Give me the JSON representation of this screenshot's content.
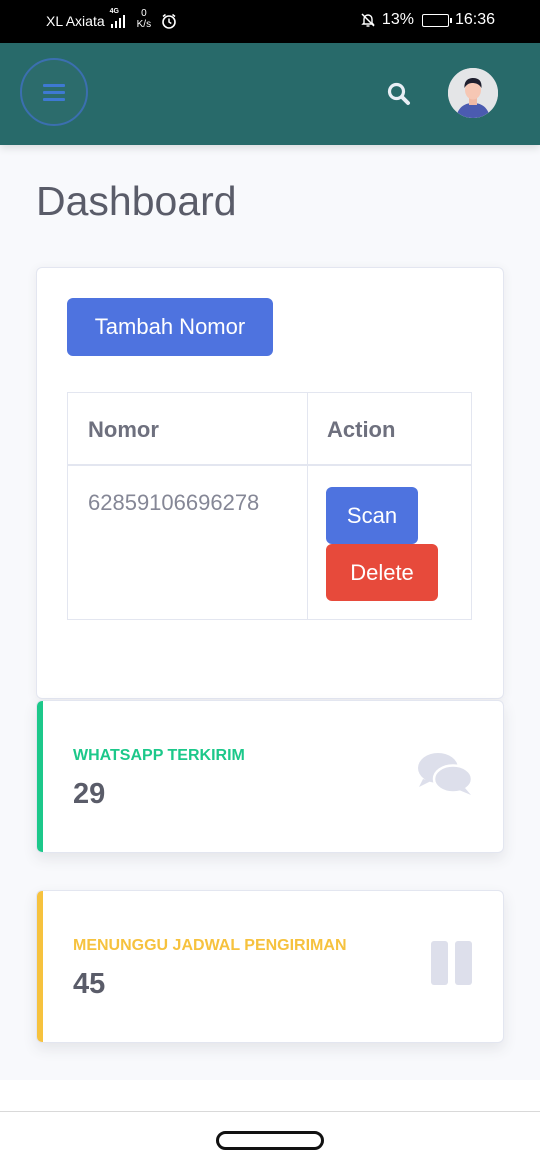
{
  "status_bar": {
    "carrier": "XL Axiata",
    "network": "4G",
    "speed_value": "0",
    "speed_unit": "K/s",
    "battery": "13%",
    "time": "16:36",
    "battery_level": 0.13,
    "battery_color": "#f5a623"
  },
  "topbar": {
    "background": "#286a6a",
    "menu_icon": "hamburger-icon",
    "search_icon": "search-icon",
    "avatar": "user-avatar"
  },
  "page": {
    "title": "Dashboard"
  },
  "numbers_card": {
    "add_button": "Tambah Nomor",
    "columns": [
      "Nomor",
      "Action"
    ],
    "rows": [
      {
        "nomor": "62859106696278",
        "actions": [
          "Scan",
          "Delete"
        ]
      }
    ]
  },
  "stats": [
    {
      "label": "WHATSAPP TERKIRIM",
      "value": "29",
      "color": "#1cc88a",
      "icon": "comments-icon"
    },
    {
      "label": "MENUNGGU JADWAL PENGIRIMAN",
      "value": "45",
      "color": "#f6c23e",
      "icon": "pause-icon"
    }
  ],
  "colors": {
    "primary": "#4e73df",
    "danger": "#e74a3b",
    "success": "#1cc88a",
    "warning": "#f6c23e"
  }
}
